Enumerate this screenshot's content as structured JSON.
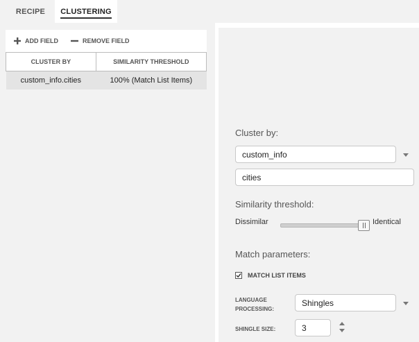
{
  "tabs": [
    {
      "label": "RECIPE",
      "active": false
    },
    {
      "label": "CLUSTERING",
      "active": true
    }
  ],
  "toolbar": {
    "add_field_label": "ADD FIELD",
    "remove_field_label": "REMOVE FIELD"
  },
  "table": {
    "columns": [
      "CLUSTER BY",
      "SIMILARITY THRESHOLD"
    ],
    "rows": [
      {
        "cluster_by": "custom_info.cities",
        "threshold": "100% (Match List Items)"
      }
    ]
  },
  "config": {
    "cluster_by_title": "Cluster by:",
    "field_select_value": "custom_info",
    "subfield_value": "cities",
    "similarity_title": "Similarity threshold:",
    "slider_min_label": "Dissimilar",
    "slider_max_label": "Identical",
    "slider_value_fraction": 1.0,
    "match_params_title": "Match parameters:",
    "match_list_items_label": "MATCH LIST ITEMS",
    "match_list_items_checked": true,
    "language_processing_label_line1": "LANGUAGE",
    "language_processing_label_line2": "PROCESSING:",
    "language_processing_value": "Shingles",
    "shingle_size_label": "SHINGLE SIZE:",
    "shingle_size_value": "3"
  },
  "colors": {
    "panel_background": "#f2f2f2",
    "selected_row": "#e4e4e4"
  }
}
